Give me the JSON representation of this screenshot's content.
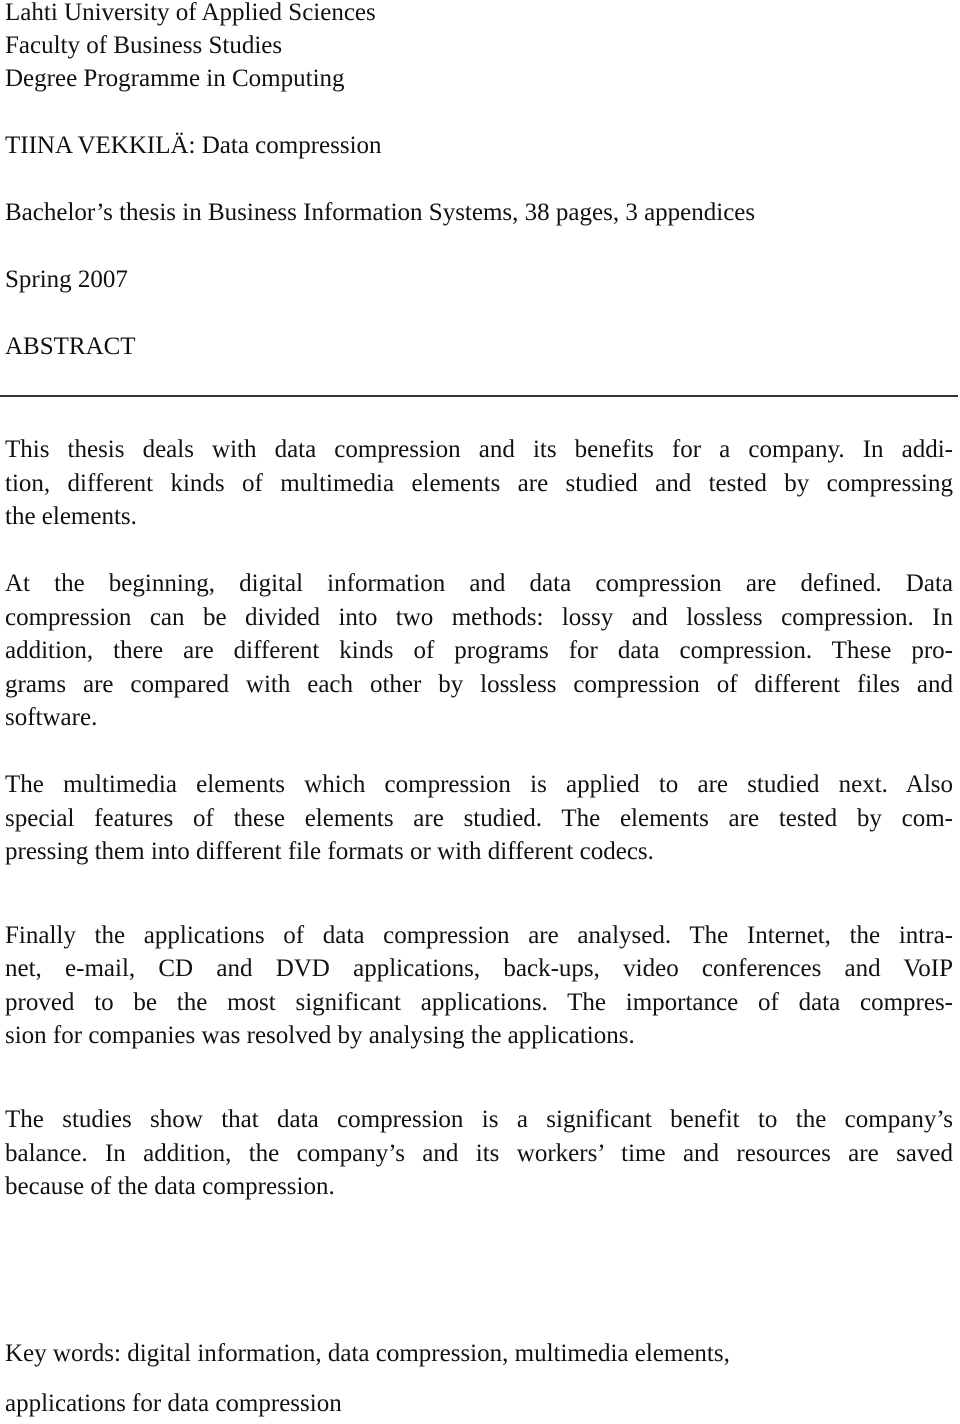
{
  "header": {
    "institution": "Lahti University of Applied Sciences",
    "faculty": "Faculty of Business Studies",
    "programme": "Degree Programme in Computing"
  },
  "title_line": "TIINA VEKKILÄ: Data compression",
  "thesis_info": "Bachelor’s thesis in Business Information Systems, 38 pages, 3 appendices",
  "term": "Spring 2007",
  "section_heading": "ABSTRACT",
  "abstract": {
    "paragraphs": [
      {
        "lines": [
          "This thesis deals with data compression and its benefits for a company. In addi-",
          "tion, different kinds of multimedia elements are studied and tested by compressing",
          "the elements."
        ]
      },
      {
        "lines": [
          "At the beginning, digital information and data compression are defined.  Data",
          "compression can be divided into two methods: lossy and lossless compression. In",
          "addition, there are different kinds of programs for data compression. These pro-",
          "grams are compared with each other by lossless compression of different files and",
          "software."
        ]
      },
      {
        "lines": [
          "The multimedia elements which compression is applied to are studied next. Also",
          "special features of these elements are studied. The elements are tested by com-",
          "pressing them into different file formats or with different codecs."
        ]
      },
      {
        "lines": [
          "Finally the applications of data compression are analysed. The Internet, the intra-",
          "net, e-mail, CD and DVD applications, back-ups, video conferences and VoIP",
          "proved to be the most significant applications. The importance of data compres-",
          "sion for companies was resolved by analysing the applications."
        ]
      },
      {
        "lines": [
          "The studies show that data compression is a significant benefit to the company’s",
          "balance. In addition, the company’s and its workers’ time and resources are saved",
          "because of the data compression."
        ]
      }
    ]
  },
  "keywords": {
    "line1": "Key words: digital information, data compression, multimedia elements,",
    "line2": "applications for data compression"
  }
}
